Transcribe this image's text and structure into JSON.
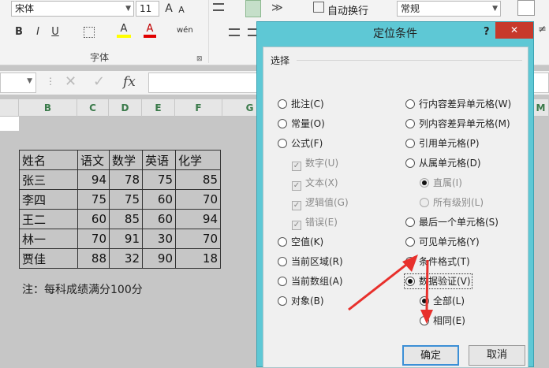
{
  "ribbon": {
    "font_name": "宋体",
    "font_size": "11",
    "grow_font": "A",
    "shrink_font": "A",
    "bold": "B",
    "italic": "I",
    "underline": "U",
    "fill_color_icon": "A",
    "font_color_icon": "A",
    "phonetic": "wén",
    "font_group_label": "字体",
    "wrap_text_label": "自动换行",
    "number_format": "常规",
    "dialog_launcher": "⊠"
  },
  "formula_bar": {
    "cancel_icon": "✕",
    "enter_icon": "✓",
    "fx_label": "fx"
  },
  "columns": [
    "B",
    "C",
    "D",
    "E",
    "F",
    "G",
    "M"
  ],
  "sheet": {
    "headers": [
      "姓名",
      "语文",
      "数学",
      "英语",
      "化学"
    ],
    "rows": [
      [
        "张三",
        "94",
        "78",
        "75",
        "85"
      ],
      [
        "李四",
        "75",
        "75",
        "60",
        "70"
      ],
      [
        "王二",
        "60",
        "85",
        "60",
        "94"
      ],
      [
        "林一",
        "70",
        "91",
        "30",
        "70"
      ],
      [
        "贾佳",
        "88",
        "32",
        "90",
        "18"
      ]
    ],
    "note": "注：每科成绩满分100分"
  },
  "dialog": {
    "title": "定位条件",
    "help": "?",
    "close": "✕",
    "section_label": "选择",
    "left_options": [
      "批注(C)",
      "常量(O)",
      "公式(F)"
    ],
    "formula_subs": [
      "数字(U)",
      "文本(X)",
      "逻辑值(G)",
      "错误(E)"
    ],
    "left_options2": [
      "空值(K)",
      "当前区域(R)",
      "当前数组(A)",
      "对象(B)"
    ],
    "right_options": [
      "行内容差异单元格(W)",
      "列内容差异单元格(M)",
      "引用单元格(P)",
      "从属单元格(D)"
    ],
    "dependents_subs": [
      "直属(I)",
      "所有级别(L)"
    ],
    "right_options2": [
      "最后一个单元格(S)",
      "可见单元格(Y)",
      "条件格式(T)",
      "数据验证(V)"
    ],
    "validation_subs": [
      "全部(L)",
      "相同(E)"
    ],
    "ok_label": "确定",
    "cancel_label": "取消"
  },
  "colors": {
    "dialog_frame": "#5ec8d5",
    "arrow": "#e8302c",
    "column_header_text": "#3a7a4a"
  }
}
